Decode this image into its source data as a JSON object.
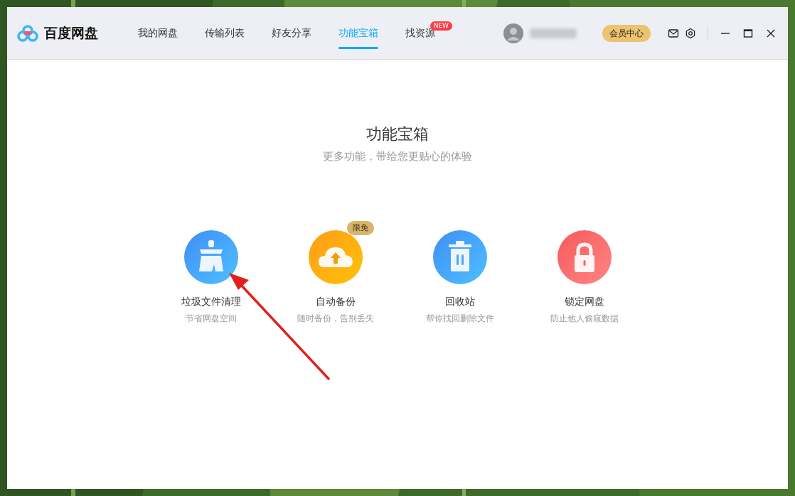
{
  "app": {
    "name": "百度网盘"
  },
  "tabs": [
    {
      "label": "我的网盘",
      "selected": false
    },
    {
      "label": "传输列表",
      "selected": false
    },
    {
      "label": "好友分享",
      "selected": false
    },
    {
      "label": "功能宝箱",
      "selected": true
    },
    {
      "label": "找资源",
      "selected": false,
      "badge": "NEW"
    }
  ],
  "vip_button": "会员中心",
  "page": {
    "title": "功能宝箱",
    "subtitle": "更多功能，带给您更贴心的体验"
  },
  "tools": [
    {
      "kind": "broom",
      "title": "垃圾文件清理",
      "description": "节省网盘空间"
    },
    {
      "kind": "backup",
      "title": "自动备份",
      "description": "随时备份，告别丢失",
      "badge": "限免"
    },
    {
      "kind": "trash",
      "title": "回收站",
      "description": "帮你找回删除文件"
    },
    {
      "kind": "lock",
      "title": "锁定网盘",
      "description": "防止他人偷窥数据"
    }
  ]
}
